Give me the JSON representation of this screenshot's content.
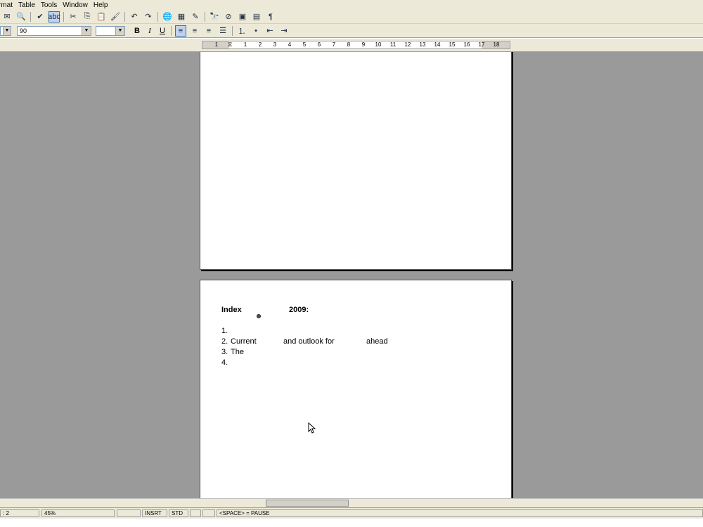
{
  "menu": [
    "rmat",
    "Table",
    "Tools",
    "Window",
    "Help"
  ],
  "toolbar_icons": [
    "email-icon",
    "page-preview-icon",
    "spellcheck-icon",
    "autospellcheck-icon",
    "cut-icon",
    "copy-icon",
    "paste-icon",
    "format-paintbrush-icon",
    "undo-icon",
    "redo-icon",
    "hyperlink-icon",
    "table-icon",
    "show-draw-functions-icon",
    "find-replace-icon",
    "navigator-icon",
    "gallery-icon",
    "data-sources-icon",
    "formatting-marks-icon"
  ],
  "format_toolbar": {
    "paragraph_style": "",
    "font_name": "90",
    "font_size": "",
    "bold_label": "B",
    "italic_label": "I",
    "underline_label": "U"
  },
  "ruler": {
    "labels": [
      "1",
      "1",
      "2",
      "3",
      "4",
      "5",
      "6",
      "7",
      "8",
      "9",
      "10",
      "11",
      "12",
      "13",
      "14",
      "15",
      "16",
      "17",
      "18"
    ]
  },
  "document": {
    "heading_left": "Index",
    "heading_right": "2009:",
    "list": [
      {
        "num": "1.",
        "parts": []
      },
      {
        "num": "2.",
        "parts": [
          "Current",
          "and  outlook for",
          "ahead"
        ]
      },
      {
        "num": "3.",
        "parts": [
          "The"
        ]
      },
      {
        "num": "4.",
        "parts": []
      }
    ]
  },
  "status": {
    "page": ": 2",
    "zoom": "45%",
    "insert_mode": "INSRT",
    "selection_mode": "STD",
    "hint": "<SPACE> = PAUSE"
  }
}
